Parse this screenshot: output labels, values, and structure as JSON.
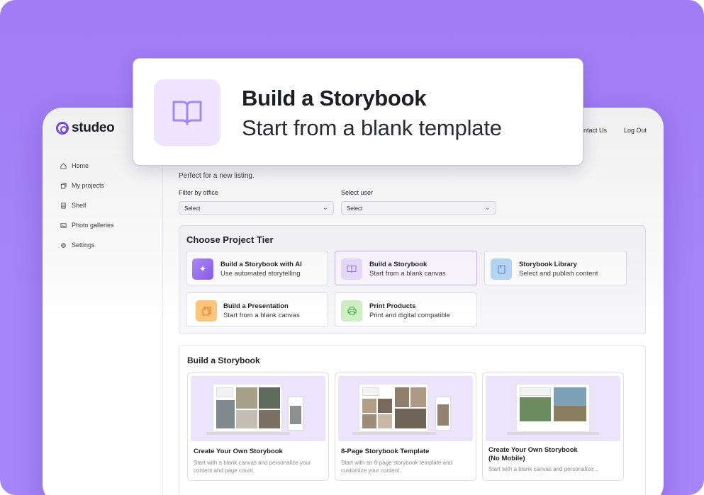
{
  "brand": {
    "name": "studeo"
  },
  "header": {
    "contact_label": "ntact Us",
    "logout_label": "Log Out"
  },
  "sidebar": {
    "items": [
      {
        "label": "Home",
        "icon": "home-icon"
      },
      {
        "label": "My projects",
        "icon": "folder-icon"
      },
      {
        "label": "Shelf",
        "icon": "shelf-icon"
      },
      {
        "label": "Photo galleries",
        "icon": "image-icon"
      },
      {
        "label": "Settings",
        "icon": "gear-icon"
      }
    ]
  },
  "main": {
    "subtitle": "Perfect for a new listing.",
    "filters": {
      "office_label": "Filter by office",
      "office_value": "Select",
      "user_label": "Select user",
      "user_value": "Select"
    }
  },
  "tiers": {
    "title": "Choose Project Tier",
    "cards": [
      {
        "title": "Build a Storybook with AI",
        "desc": "Use automated storytelling",
        "icon": "sparkle-icon",
        "color": "#9b6cf0"
      },
      {
        "title": "Build a Storybook",
        "desc": "Start from a blank canvas",
        "icon": "book-icon",
        "color": "#e8dcfd",
        "selected": true
      },
      {
        "title": "Storybook Library",
        "desc": "Select and publish content",
        "icon": "library-icon",
        "color": "#a9cdf5"
      },
      {
        "title": "Build a Presentation",
        "desc": "Start from a blank canvas",
        "icon": "presentation-icon",
        "color": "#fbc27a"
      },
      {
        "title": "Print Products",
        "desc": "Print and digital compatible",
        "icon": "printer-icon",
        "color": "#c9efc0"
      }
    ]
  },
  "storybook": {
    "title": "Build a Storybook",
    "templates": [
      {
        "title": "Create Your Own Storybook",
        "desc": "Start with a blank canvas and personalize your content and page count."
      },
      {
        "title": "8-Page Storybook Template",
        "desc": "Start with an 8-page storybook template and customize your content."
      },
      {
        "title": "Create Your Own Storybook\n(No Mobile)",
        "title_line1": "Create Your Own Storybook",
        "title_line2": "(No Mobile)",
        "desc": "Start with a blank canvas and personalize..."
      }
    ]
  },
  "popup": {
    "title": "Build a Storybook",
    "subtitle": "Start from a blank template",
    "icon": "book-icon"
  },
  "colors": {
    "background": "#a585f8",
    "accent": "#7c4df0",
    "selected_border": "#c8b3f7"
  }
}
